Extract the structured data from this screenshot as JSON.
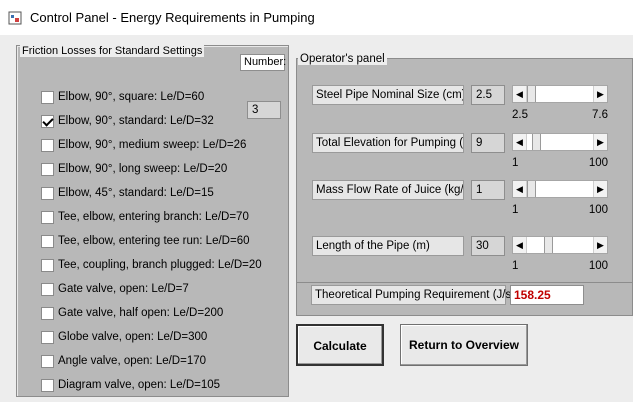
{
  "window": {
    "title": "Control Panel - Energy Requirements in Pumping"
  },
  "friction": {
    "caption": "Friction Losses for Standard Settings",
    "number_label": "Number:",
    "items": [
      {
        "label": "Elbow, 90°, square: Le/D=60",
        "checked": false
      },
      {
        "label": "Elbow, 90°, standard: Le/D=32",
        "checked": true
      },
      {
        "label": "Elbow, 90°, medium sweep: Le/D=26",
        "checked": false
      },
      {
        "label": "Elbow, 90°, long sweep: Le/D=20",
        "checked": false
      },
      {
        "label": "Elbow, 45°, standard: Le/D=15",
        "checked": false
      },
      {
        "label": "Tee, elbow, entering branch: Le/D=70",
        "checked": false
      },
      {
        "label": "Tee, elbow, entering tee run: Le/D=60",
        "checked": false
      },
      {
        "label": "Tee, coupling, branch plugged: Le/D=20",
        "checked": false
      },
      {
        "label": "Gate valve, open: Le/D=7",
        "checked": false
      },
      {
        "label": "Gate valve, half open: Le/D=200",
        "checked": false
      },
      {
        "label": "Globe valve, open: Le/D=300",
        "checked": false
      },
      {
        "label": "Angle valve, open: Le/D=170",
        "checked": false
      },
      {
        "label": "Diagram valve, open: Le/D=105",
        "checked": false
      }
    ],
    "selected_number": "3"
  },
  "operator": {
    "caption": "Operator's panel",
    "params": [
      {
        "label": "Steel Pipe Nominal Size (cm)",
        "value": "2.5",
        "min": "2.5",
        "max": "7.6",
        "position": 0.0
      },
      {
        "label": "Total Elevation for Pumping (m)",
        "value": "9",
        "min": "1",
        "max": "100",
        "position": 0.08
      },
      {
        "label": "Mass Flow Rate of Juice (kg/s)",
        "value": "1",
        "min": "1",
        "max": "100",
        "position": 0.0
      },
      {
        "label": "Length of the Pipe (m)",
        "value": "30",
        "min": "1",
        "max": "100",
        "position": 0.29
      }
    ],
    "result_label": "Theoretical Pumping Requirement (J/s)",
    "result_value": "158.25"
  },
  "buttons": {
    "calculate": "Calculate",
    "return": "Return to Overview"
  },
  "colors": {
    "panel": "#b8b8b8",
    "result_text": "#c00000"
  }
}
